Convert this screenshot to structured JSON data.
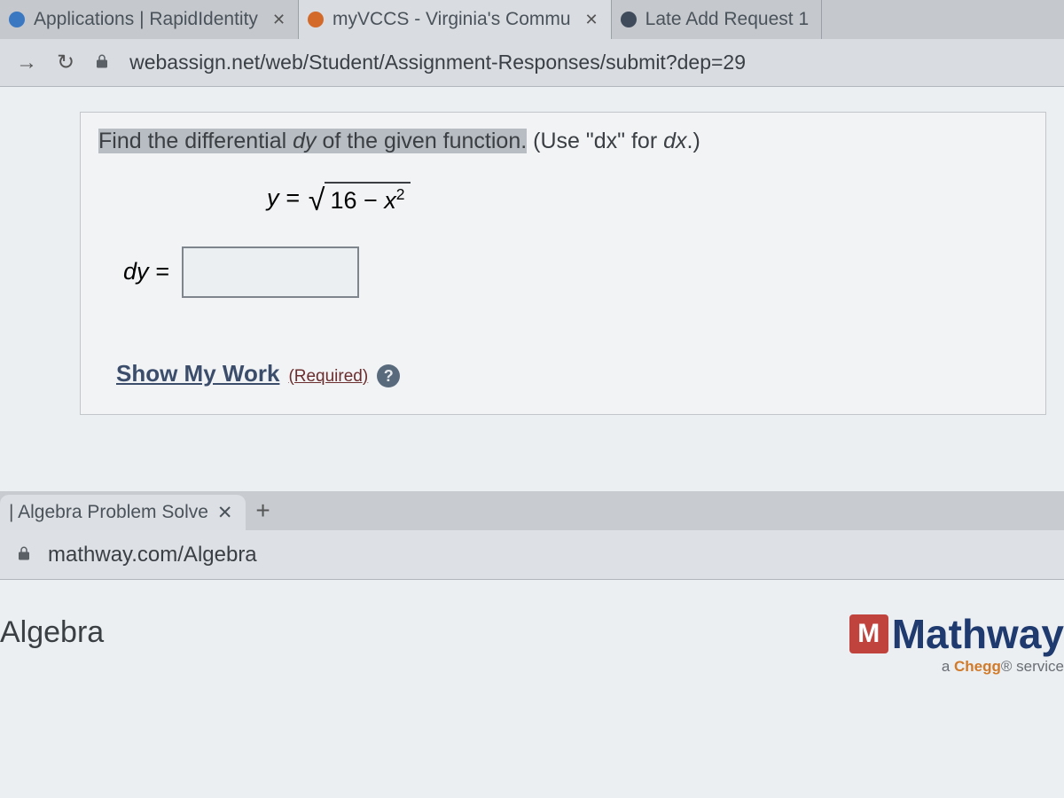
{
  "topWindow": {
    "tabs": [
      {
        "label": "Applications | RapidIdentity"
      },
      {
        "label": "myVCCS - Virginia's Commu"
      },
      {
        "label": "Late Add Request 1"
      }
    ],
    "url": "webassign.net/web/Student/Assignment-Responses/submit?dep=29",
    "problem": {
      "prompt_pre": "Find the differential ",
      "prompt_dy": "dy",
      "prompt_mid": " of the given function.",
      "prompt_tail": " (Use \"dx\" for ",
      "prompt_dx": "dx",
      "prompt_end": ".)",
      "eq_lhs": "y =",
      "eq_radicand_a": "16 − ",
      "eq_radicand_b": "x",
      "eq_radicand_exp": "2",
      "answer_label": "dy =",
      "answer_value": "",
      "showwork_title": "Show My Work",
      "showwork_req": "(Required)",
      "help_char": "?"
    }
  },
  "bottomWindow": {
    "tab_label": "| Algebra Problem Solve",
    "url": "mathway.com/Algebra",
    "page_title": "Algebra",
    "brand_name": "Mathway",
    "brand_initial": "M",
    "brand_tag_pre": "a ",
    "brand_tag_chegg": "Chegg",
    "brand_tag_post": "® service"
  }
}
